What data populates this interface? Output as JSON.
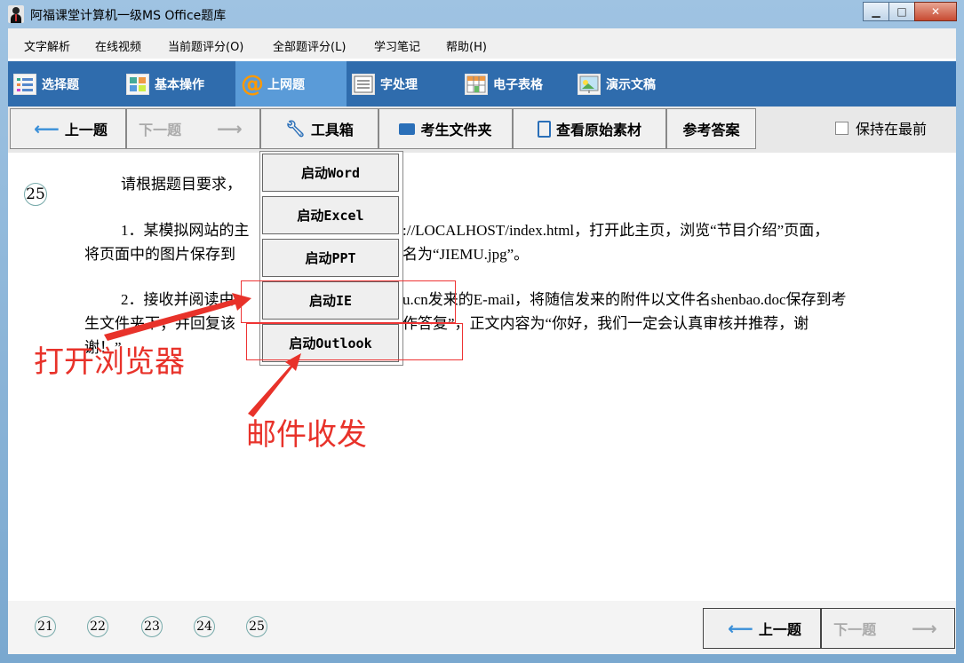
{
  "window": {
    "title": "阿福课堂计算机一级MS Office题库",
    "controls": {
      "minimize": "▁",
      "maximize": "□",
      "close": "✕"
    }
  },
  "menu": [
    "文字解析",
    "在线视频",
    "当前题评分(O)",
    "全部题评分(L)",
    "学习笔记",
    "帮助(H)"
  ],
  "tabs": [
    {
      "label": "选择题",
      "icon": "list-icon"
    },
    {
      "label": "基本操作",
      "icon": "grid-icon"
    },
    {
      "label": "上网题",
      "icon": "at-icon"
    },
    {
      "label": "字处理",
      "icon": "document-icon"
    },
    {
      "label": "电子表格",
      "icon": "spreadsheet-icon"
    },
    {
      "label": "演示文稿",
      "icon": "slides-icon"
    }
  ],
  "toolbar": {
    "prev": "上一题",
    "next": "下一题",
    "toolbox": "工具箱",
    "folder": "考生文件夹",
    "material": "查看原始素材",
    "answer": "参考答案",
    "keep_on_top": "保持在最前"
  },
  "question": {
    "number": "25",
    "p0": "请根据题目要求，",
    "p1a": "1．某模拟网站的主",
    "p1b": "://LOCALHOST/index.html，打开此主页，浏览“节目介绍”页面，",
    "p1c": "将页面中的图片保存到",
    "p1d": "名为“JIEMU.jpg”。",
    "p2a": "2．接收并阅读由x",
    "p2b": "u.cn发来的E-mail，将随信发来的附件以文件名shenbao.doc保存到考",
    "p2c": "生文件夹下；并回复该",
    "p2d": "作答复”，正文内容为“你好，我们一定会认真审核并推荐，谢",
    "p2e": "谢！”"
  },
  "dropdown": [
    "启动Word",
    "启动Excel",
    "启动PPT",
    "启动IE",
    "启动Outlook"
  ],
  "annotations": {
    "browser": "打开浏览器",
    "mail": "邮件收发"
  },
  "footer": {
    "numbers": [
      "21",
      "22",
      "23",
      "24",
      "25"
    ],
    "prev": "上一题",
    "next": "下一题"
  },
  "colors": {
    "tab_bar": "#2f6cad",
    "active_tab": "#5a9bd8",
    "annotation": "#e8322a"
  }
}
